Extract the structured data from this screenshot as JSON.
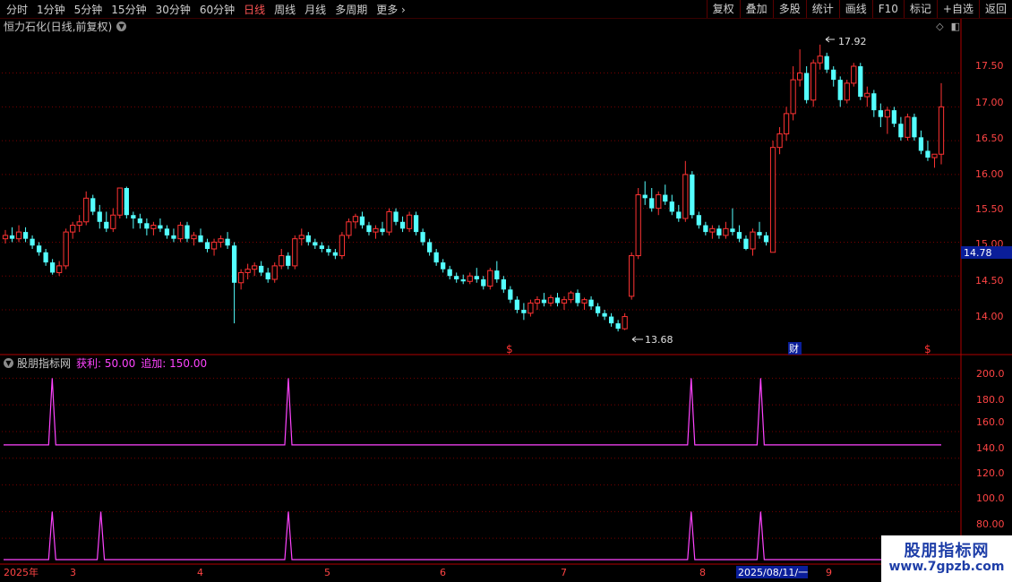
{
  "toolbar": {
    "periods": [
      "分时",
      "1分钟",
      "5分钟",
      "15分钟",
      "30分钟",
      "60分钟",
      "日线",
      "周线",
      "月线",
      "多周期",
      "更多"
    ],
    "active_index": 6,
    "right_buttons": [
      "复权",
      "叠加",
      "多股",
      "统计",
      "画线",
      "F10",
      "标记",
      "+自选",
      "返回"
    ]
  },
  "main_chart": {
    "title": "恒力石化(日线,前复权)",
    "high_label": "17.92",
    "low_label": "13.68",
    "current_price": "14.78",
    "event_markers": [
      "$",
      "财",
      "$"
    ],
    "y_ticks": [
      "17.50",
      "17.00",
      "16.50",
      "16.00",
      "15.50",
      "15.00",
      "14.50",
      "14.00"
    ]
  },
  "indicator": {
    "name": "股朋指标网",
    "value1_label": "获利:",
    "value1": "50.00",
    "value2_label": "追加:",
    "value2": "150.00",
    "y_ticks": [
      "200.0",
      "180.0",
      "160.0",
      "140.0",
      "120.0",
      "100.0",
      "80.00"
    ]
  },
  "date_axis": {
    "labels": [
      "2025年",
      "3",
      "4",
      "5",
      "6",
      "7",
      "8",
      "9"
    ],
    "cursor_date": "2025/08/11/一"
  },
  "watermark": {
    "line1": "股朋指标网",
    "line2": "www.7gpzb.com"
  },
  "colors": {
    "up": "#ff3333",
    "down": "#54ffff",
    "indicator": "#ff44ff",
    "grid": "#7a0000",
    "axis_text": "#ff4444"
  },
  "chart_data": {
    "type": "candlestick",
    "price_range": [
      13.55,
      18.05
    ],
    "indicator_range": [
      62,
      215
    ],
    "candles": [
      [
        15.05,
        15.18,
        14.98,
        15.1
      ],
      [
        15.1,
        15.22,
        15.0,
        15.05
      ],
      [
        15.05,
        15.25,
        15.0,
        15.15
      ],
      [
        15.15,
        15.22,
        15.0,
        15.05
      ],
      [
        15.05,
        15.1,
        14.9,
        14.95
      ],
      [
        14.95,
        15.0,
        14.8,
        14.85
      ],
      [
        14.85,
        14.9,
        14.65,
        14.7
      ],
      [
        14.7,
        14.75,
        14.52,
        14.55
      ],
      [
        14.55,
        14.72,
        14.5,
        14.65
      ],
      [
        14.65,
        15.2,
        14.6,
        15.15
      ],
      [
        15.15,
        15.3,
        15.05,
        15.25
      ],
      [
        15.25,
        15.4,
        15.15,
        15.3
      ],
      [
        15.3,
        15.75,
        15.25,
        15.65
      ],
      [
        15.65,
        15.7,
        15.4,
        15.45
      ],
      [
        15.45,
        15.55,
        15.2,
        15.3
      ],
      [
        15.3,
        15.45,
        15.15,
        15.2
      ],
      [
        15.2,
        15.5,
        15.15,
        15.4
      ],
      [
        15.4,
        15.8,
        15.35,
        15.8
      ],
      [
        15.8,
        15.82,
        15.35,
        15.4
      ],
      [
        15.4,
        15.45,
        15.2,
        15.35
      ],
      [
        15.35,
        15.42,
        15.2,
        15.28
      ],
      [
        15.28,
        15.35,
        15.1,
        15.2
      ],
      [
        15.2,
        15.3,
        15.1,
        15.25
      ],
      [
        15.25,
        15.35,
        15.15,
        15.2
      ],
      [
        15.2,
        15.25,
        15.05,
        15.1
      ],
      [
        15.1,
        15.2,
        15.0,
        15.05
      ],
      [
        15.05,
        15.3,
        15.0,
        15.25
      ],
      [
        15.25,
        15.3,
        15.0,
        15.05
      ],
      [
        15.05,
        15.15,
        14.95,
        15.1
      ],
      [
        15.1,
        15.2,
        15.0,
        15.0
      ],
      [
        15.0,
        15.05,
        14.85,
        14.9
      ],
      [
        14.9,
        15.05,
        14.8,
        15.0
      ],
      [
        15.0,
        15.1,
        14.92,
        15.05
      ],
      [
        15.05,
        15.15,
        14.9,
        14.95
      ],
      [
        14.95,
        15.0,
        13.8,
        14.4
      ],
      [
        14.4,
        14.6,
        14.3,
        14.55
      ],
      [
        14.55,
        14.68,
        14.45,
        14.6
      ],
      [
        14.6,
        14.7,
        14.5,
        14.65
      ],
      [
        14.65,
        14.72,
        14.5,
        14.55
      ],
      [
        14.55,
        14.62,
        14.4,
        14.45
      ],
      [
        14.45,
        14.7,
        14.4,
        14.65
      ],
      [
        14.65,
        14.9,
        14.6,
        14.8
      ],
      [
        14.8,
        14.85,
        14.6,
        14.65
      ],
      [
        14.65,
        15.1,
        14.6,
        15.05
      ],
      [
        15.05,
        15.2,
        14.95,
        15.1
      ],
      [
        15.1,
        15.15,
        14.95,
        15.0
      ],
      [
        15.0,
        15.05,
        14.9,
        14.95
      ],
      [
        14.95,
        15.0,
        14.85,
        14.9
      ],
      [
        14.9,
        14.95,
        14.8,
        14.85
      ],
      [
        14.85,
        14.9,
        14.75,
        14.8
      ],
      [
        14.8,
        15.15,
        14.75,
        15.1
      ],
      [
        15.1,
        15.35,
        15.05,
        15.3
      ],
      [
        15.3,
        15.42,
        15.2,
        15.38
      ],
      [
        15.38,
        15.45,
        15.2,
        15.25
      ],
      [
        15.25,
        15.3,
        15.1,
        15.15
      ],
      [
        15.15,
        15.25,
        15.05,
        15.2
      ],
      [
        15.2,
        15.3,
        15.1,
        15.15
      ],
      [
        15.15,
        15.5,
        15.1,
        15.45
      ],
      [
        15.45,
        15.5,
        15.25,
        15.3
      ],
      [
        15.3,
        15.38,
        15.15,
        15.2
      ],
      [
        15.2,
        15.45,
        15.15,
        15.4
      ],
      [
        15.4,
        15.45,
        15.1,
        15.15
      ],
      [
        15.15,
        15.2,
        14.95,
        15.0
      ],
      [
        15.0,
        15.05,
        14.8,
        14.85
      ],
      [
        14.85,
        14.9,
        14.65,
        14.7
      ],
      [
        14.7,
        14.75,
        14.55,
        14.6
      ],
      [
        14.6,
        14.65,
        14.45,
        14.5
      ],
      [
        14.5,
        14.55,
        14.4,
        14.45
      ],
      [
        14.45,
        14.52,
        14.38,
        14.42
      ],
      [
        14.42,
        14.55,
        14.38,
        14.5
      ],
      [
        14.5,
        14.62,
        14.4,
        14.45
      ],
      [
        14.45,
        14.5,
        14.3,
        14.35
      ],
      [
        14.35,
        14.62,
        14.3,
        14.58
      ],
      [
        14.58,
        14.72,
        14.4,
        14.45
      ],
      [
        14.45,
        14.5,
        14.25,
        14.3
      ],
      [
        14.3,
        14.35,
        14.1,
        14.15
      ],
      [
        14.15,
        14.2,
        13.95,
        14.0
      ],
      [
        14.0,
        14.1,
        13.85,
        13.95
      ],
      [
        13.95,
        14.15,
        13.9,
        14.1
      ],
      [
        14.1,
        14.2,
        14.0,
        14.15
      ],
      [
        14.15,
        14.25,
        14.05,
        14.1
      ],
      [
        14.1,
        14.22,
        14.05,
        14.18
      ],
      [
        14.18,
        14.25,
        14.05,
        14.1
      ],
      [
        14.1,
        14.2,
        14.0,
        14.15
      ],
      [
        14.15,
        14.28,
        14.1,
        14.25
      ],
      [
        14.25,
        14.3,
        14.05,
        14.1
      ],
      [
        14.1,
        14.18,
        14.0,
        14.15
      ],
      [
        14.15,
        14.2,
        14.0,
        14.05
      ],
      [
        14.05,
        14.1,
        13.9,
        13.95
      ],
      [
        13.95,
        14.0,
        13.85,
        13.9
      ],
      [
        13.9,
        13.95,
        13.75,
        13.8
      ],
      [
        13.8,
        13.85,
        13.68,
        13.72
      ],
      [
        13.72,
        13.95,
        13.7,
        13.9
      ],
      [
        14.2,
        14.85,
        14.15,
        14.8
      ],
      [
        14.8,
        15.8,
        14.75,
        15.7
      ],
      [
        15.7,
        15.9,
        15.55,
        15.65
      ],
      [
        15.65,
        15.8,
        15.45,
        15.5
      ],
      [
        15.5,
        15.75,
        15.4,
        15.7
      ],
      [
        15.7,
        15.85,
        15.55,
        15.6
      ],
      [
        15.6,
        15.7,
        15.4,
        15.45
      ],
      [
        15.45,
        15.55,
        15.3,
        15.35
      ],
      [
        15.35,
        16.2,
        15.3,
        16.0
      ],
      [
        16.0,
        16.05,
        15.35,
        15.4
      ],
      [
        15.4,
        15.45,
        15.2,
        15.25
      ],
      [
        15.25,
        15.3,
        15.1,
        15.15
      ],
      [
        15.15,
        15.25,
        15.05,
        15.2
      ],
      [
        15.2,
        15.25,
        15.05,
        15.1
      ],
      [
        15.1,
        15.3,
        15.05,
        15.2
      ],
      [
        15.2,
        15.5,
        15.1,
        15.15
      ],
      [
        15.15,
        15.25,
        15.0,
        15.05
      ],
      [
        15.05,
        15.1,
        14.88,
        14.9
      ],
      [
        14.9,
        15.2,
        14.8,
        15.15
      ],
      [
        15.15,
        15.3,
        15.05,
        15.1
      ],
      [
        15.1,
        15.15,
        14.95,
        15.0
      ],
      [
        14.85,
        16.5,
        14.85,
        16.4
      ],
      [
        16.4,
        16.7,
        16.3,
        16.6
      ],
      [
        16.6,
        17.0,
        16.5,
        16.9
      ],
      [
        16.9,
        17.6,
        16.8,
        17.4
      ],
      [
        17.4,
        17.85,
        17.3,
        17.5
      ],
      [
        17.5,
        17.6,
        17.05,
        17.1
      ],
      [
        17.1,
        17.7,
        17.0,
        17.65
      ],
      [
        17.65,
        17.92,
        17.55,
        17.75
      ],
      [
        17.75,
        17.8,
        17.5,
        17.55
      ],
      [
        17.55,
        17.6,
        17.3,
        17.4
      ],
      [
        17.4,
        17.45,
        17.0,
        17.1
      ],
      [
        17.1,
        17.4,
        17.05,
        17.35
      ],
      [
        17.35,
        17.65,
        17.3,
        17.6
      ],
      [
        17.6,
        17.65,
        17.1,
        17.15
      ],
      [
        17.15,
        17.3,
        17.0,
        17.2
      ],
      [
        17.2,
        17.25,
        16.85,
        16.95
      ],
      [
        16.95,
        17.05,
        16.7,
        16.85
      ],
      [
        16.85,
        17.0,
        16.6,
        16.95
      ],
      [
        16.95,
        17.0,
        16.7,
        16.75
      ],
      [
        16.75,
        16.85,
        16.5,
        16.55
      ],
      [
        16.55,
        16.9,
        16.5,
        16.85
      ],
      [
        16.85,
        16.9,
        16.5,
        16.55
      ],
      [
        16.55,
        16.65,
        16.3,
        16.35
      ],
      [
        16.35,
        16.5,
        16.2,
        16.25
      ],
      [
        16.25,
        16.3,
        16.1,
        16.3
      ],
      [
        16.3,
        17.35,
        16.15,
        17.0
      ]
    ],
    "series": [
      {
        "name": "获利",
        "values": [
          50,
          50,
          50,
          50,
          50,
          50,
          50,
          200,
          50,
          50,
          50,
          50,
          50,
          50,
          50,
          50,
          50,
          50,
          50,
          50,
          50,
          50,
          50,
          50,
          50,
          50,
          50,
          50,
          50,
          50,
          50,
          50,
          50,
          50,
          50,
          50,
          50,
          50,
          50,
          50,
          50,
          50,
          50,
          50,
          50,
          50,
          50,
          50,
          50,
          50,
          50,
          50,
          50,
          50,
          50,
          50,
          50,
          50,
          50,
          50,
          50,
          50,
          50,
          50,
          50,
          50,
          50,
          50,
          50,
          50,
          50,
          50,
          50,
          50,
          50,
          50,
          50,
          50,
          50,
          50,
          50,
          50,
          50,
          50,
          50,
          50,
          50,
          50,
          50,
          50,
          50,
          50,
          50,
          50,
          50,
          50,
          50,
          50,
          50,
          50,
          50,
          50,
          50,
          50,
          50,
          50,
          50,
          50,
          50,
          50,
          50,
          50,
          50,
          50,
          50,
          50,
          50,
          50,
          50,
          50,
          50,
          50,
          50,
          50,
          50,
          50,
          50,
          50,
          50,
          50,
          50,
          50,
          50,
          50,
          50,
          50
        ]
      },
      {
        "name": "追加",
        "values": [
          150,
          150,
          150,
          150,
          150,
          150,
          150,
          200,
          150,
          150,
          150,
          150,
          150,
          150,
          150,
          150,
          150,
          150,
          150,
          150,
          150,
          150,
          150,
          150,
          150,
          150,
          150,
          150,
          150,
          150,
          150,
          150,
          150,
          150,
          150,
          150,
          150,
          150,
          150,
          150,
          150,
          150,
          150,
          150,
          150,
          150,
          150,
          150,
          150,
          150,
          150,
          150,
          150,
          150,
          150,
          150,
          150,
          150,
          150,
          150,
          150,
          150,
          150,
          150,
          150,
          150,
          150,
          150,
          150,
          150,
          150,
          150,
          150,
          150,
          150,
          150,
          150,
          150,
          150,
          150,
          150,
          150,
          150,
          150,
          150,
          150,
          150,
          150,
          150,
          150,
          150,
          150,
          150,
          150,
          150,
          150,
          150,
          150,
          150,
          150,
          150,
          150,
          150,
          150,
          150,
          150,
          150,
          150,
          150,
          150,
          150,
          150,
          150,
          150,
          150,
          150,
          150,
          150,
          150,
          150,
          150,
          150,
          150,
          150,
          150,
          150,
          150,
          150,
          150,
          150,
          150,
          150,
          150,
          150,
          150,
          150
        ]
      }
    ],
    "spikes_top": [
      7,
      41,
      99,
      109
    ],
    "spikes_bottom": [
      7,
      14,
      41,
      99,
      109
    ],
    "spike_top_value": 200,
    "spike_bottom_value": 100
  }
}
